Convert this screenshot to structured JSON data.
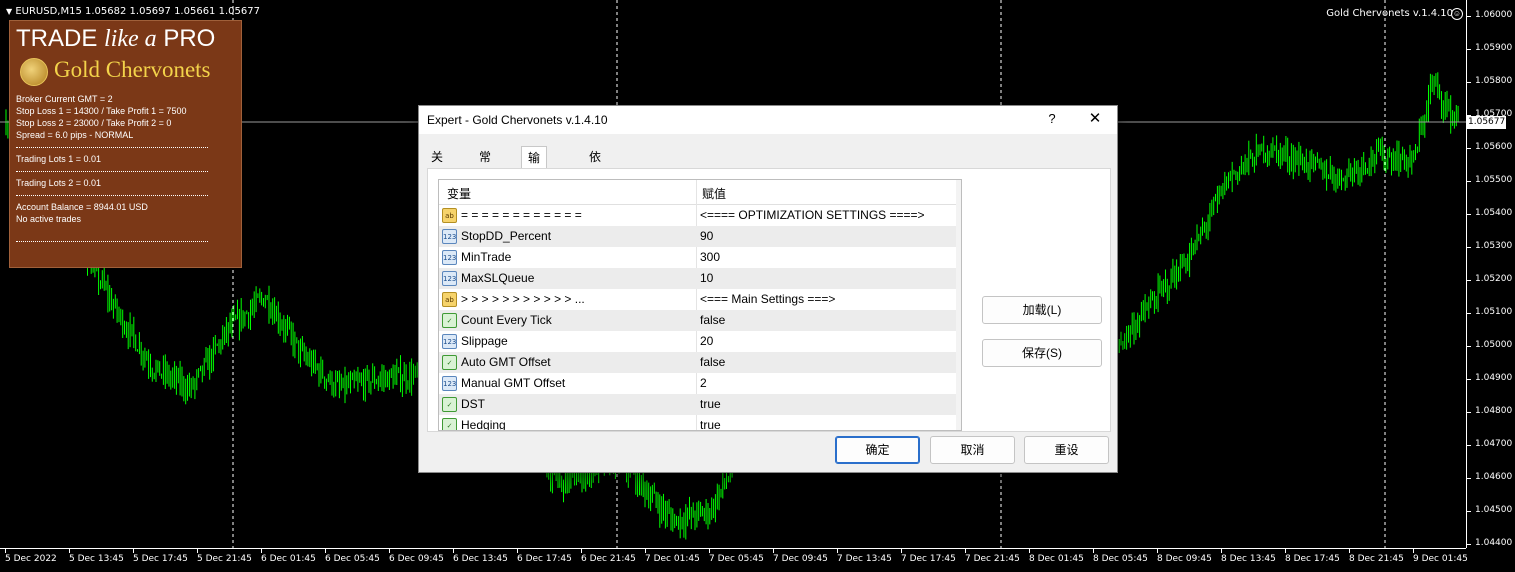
{
  "chart": {
    "header_text": "EURUSD,M15  1.05682 1.05697 1.05661 1.05677",
    "ea_title": "Gold Chervonets v.1.4.10",
    "ea_icon": "smiley-icon",
    "current_price": "1.05677",
    "candle_color": "#00ff00",
    "price_labels": [
      "1.06000",
      "1.05900",
      "1.05800",
      "1.05700",
      "1.05600",
      "1.05500",
      "1.05400",
      "1.05300",
      "1.05200",
      "1.05100",
      "1.05000",
      "1.04900",
      "1.04800",
      "1.04700",
      "1.04600",
      "1.04500",
      "1.04400"
    ],
    "time_labels": [
      "5 Dec 2022",
      "5 Dec 13:45",
      "5 Dec 17:45",
      "5 Dec 21:45",
      "6 Dec 01:45",
      "6 Dec 05:45",
      "6 Dec 09:45",
      "6 Dec 13:45",
      "6 Dec 17:45",
      "6 Dec 21:45",
      "7 Dec 01:45",
      "7 Dec 05:45",
      "7 Dec 09:45",
      "7 Dec 13:45",
      "7 Dec 17:45",
      "7 Dec 21:45",
      "8 Dec 01:45",
      "8 Dec 05:45",
      "8 Dec 09:45",
      "8 Dec 13:45",
      "8 Dec 17:45",
      "8 Dec 21:45",
      "9 Dec 01:45"
    ]
  },
  "info_panel": {
    "logo_trade": "TRADE",
    "logo_like_a": "like a",
    "logo_pro": "PRO",
    "logo_product": "Gold Chervonets",
    "broker_gmt": "Broker Current GMT = 2",
    "sl_tp_1": "Stop Loss 1 = 14300 / Take Profit 1 = 7500",
    "sl_tp_2": "Stop Loss 2 = 23000 / Take Profit 2 = 0",
    "spread": "Spread = 6.0 pips - NORMAL",
    "lots_1": "Trading Lots 1 = 0.01",
    "lots_2": "Trading Lots 2 = 0.01",
    "balance": "Account Balance = 8944.01 USD",
    "trades": "No active trades"
  },
  "dialog": {
    "title": "Expert - Gold Chervonets v.1.4.10",
    "help": "?",
    "close": "✕",
    "tabs": [
      {
        "label": "关于"
      },
      {
        "label": "常用"
      },
      {
        "label": "输入参数",
        "active": true
      },
      {
        "label": "依存关系"
      }
    ],
    "grid_headers": {
      "variable": "变量",
      "value": "赋值"
    },
    "rows": [
      {
        "icon": "ab",
        "name": "= = = = = = = = = = = =",
        "value": "<==== OPTIMIZATION SETTINGS ====>"
      },
      {
        "icon": "123",
        "name": "StopDD_Percent",
        "value": "90"
      },
      {
        "icon": "123",
        "name": "MinTrade",
        "value": "300"
      },
      {
        "icon": "123",
        "name": "MaxSLQueue",
        "value": "10"
      },
      {
        "icon": "ab",
        "name": ">  >  >  >  >  >  >  >  >  >  >  ...",
        "value": "<=== Main Settings ===>"
      },
      {
        "icon": "bool",
        "name": "Count Every Tick",
        "value": "false"
      },
      {
        "icon": "123",
        "name": "Slippage",
        "value": "20"
      },
      {
        "icon": "bool",
        "name": "Auto GMT Offset",
        "value": "false"
      },
      {
        "icon": "123",
        "name": "Manual GMT Offset",
        "value": "2"
      },
      {
        "icon": "bool",
        "name": "DST",
        "value": "true"
      },
      {
        "icon": "bool",
        "name": "Hedging",
        "value": "true"
      }
    ],
    "buttons": {
      "load": "加载(L)",
      "save": "保存(S)",
      "ok": "确定",
      "cancel": "取消",
      "reset": "重设"
    }
  }
}
